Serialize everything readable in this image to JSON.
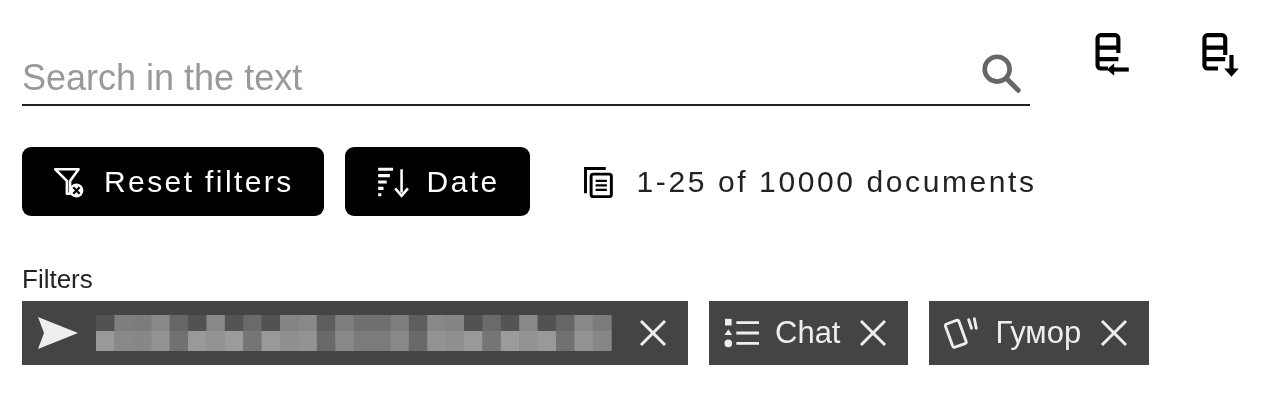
{
  "search": {
    "placeholder": "Search in the text"
  },
  "toolbar_buttons": [
    {
      "kind": "import"
    },
    {
      "kind": "download"
    }
  ],
  "actions": [
    {
      "kind": "reset",
      "label": "Reset filters"
    },
    {
      "kind": "sort",
      "label": "Date"
    }
  ],
  "count": "1-25 of 10000 documents",
  "filters": {
    "label": "Filters",
    "chips": [
      {
        "kind": "send",
        "redacted": true
      },
      {
        "kind": "list",
        "label": "Chat"
      },
      {
        "kind": "cards",
        "label": "Гумор"
      }
    ]
  }
}
